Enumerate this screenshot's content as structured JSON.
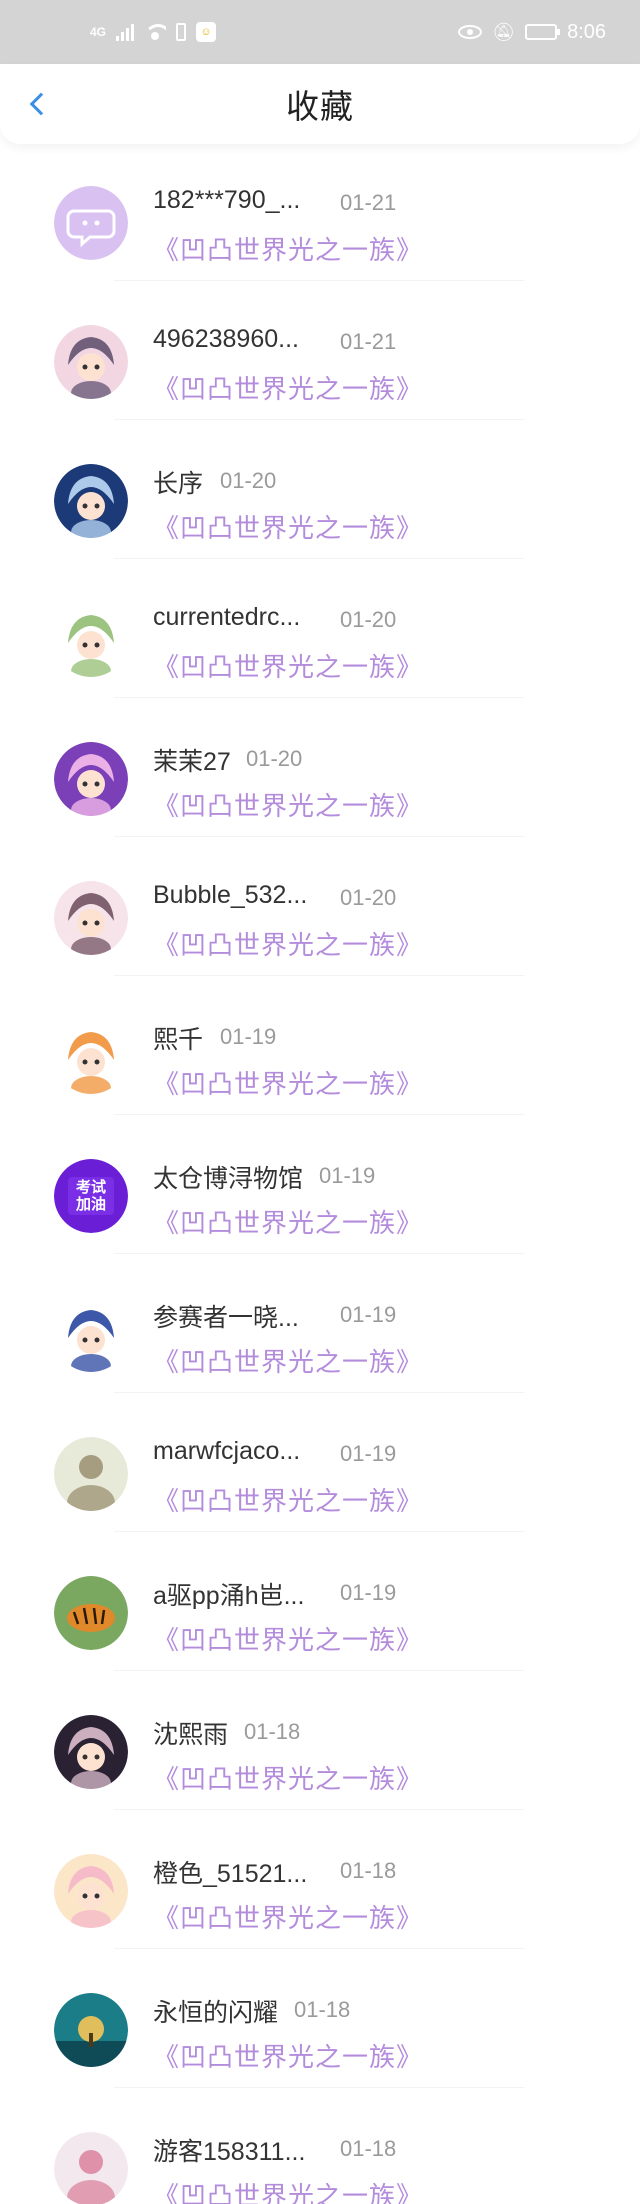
{
  "status_bar": {
    "carrier_badge": "4G",
    "time": "8:06",
    "icons": [
      "signal-icon",
      "wifi-icon",
      "battery-mini-icon",
      "notification-app-icon",
      "eye-icon",
      "bell-muted-icon",
      "battery-icon"
    ]
  },
  "header": {
    "title": "收藏",
    "back_icon": "chevron-left-icon",
    "accent": "#3a8ee6"
  },
  "work_title_color": "#b48cdc",
  "items": [
    {
      "user": "182***790_...",
      "date": "01-21",
      "work": "《凹凸世界光之一族》",
      "avatar": "chat-bubble-avatar"
    },
    {
      "user": "496238960...",
      "date": "01-21",
      "work": "《凹凸世界光之一族》",
      "avatar": "anime-avatar"
    },
    {
      "user": "长序",
      "date": "01-20",
      "work": "《凹凸世界光之一族》",
      "avatar": "anime-avatar"
    },
    {
      "user": "currentedrc...",
      "date": "01-20",
      "work": "《凹凸世界光之一族》",
      "avatar": "anime-avatar"
    },
    {
      "user": "茉茉27",
      "date": "01-20",
      "work": "《凹凸世界光之一族》",
      "avatar": "anime-avatar"
    },
    {
      "user": "Bubble_532...",
      "date": "01-20",
      "work": "《凹凸世界光之一族》",
      "avatar": "anime-avatar"
    },
    {
      "user": "熙千",
      "date": "01-19",
      "work": "《凹凸世界光之一族》",
      "avatar": "anime-avatar"
    },
    {
      "user": "太仓博浔物馆",
      "date": "01-19",
      "work": "《凹凸世界光之一族》",
      "avatar": "text-badge-avatar",
      "avatar_text": "考试加油"
    },
    {
      "user": "参赛者一晓...",
      "date": "01-19",
      "work": "《凹凸世界光之一族》",
      "avatar": "anime-avatar"
    },
    {
      "user": "marwfcjaco...",
      "date": "01-19",
      "work": "《凹凸世界光之一族》",
      "avatar": "photo-avatar"
    },
    {
      "user": "a驱pp涌h岜...",
      "date": "01-19",
      "work": "《凹凸世界光之一族》",
      "avatar": "tiger-avatar"
    },
    {
      "user": "沈熙雨",
      "date": "01-18",
      "work": "《凹凸世界光之一族》",
      "avatar": "anime-avatar"
    },
    {
      "user": "橙色_51521...",
      "date": "01-18",
      "work": "《凹凸世界光之一族》",
      "avatar": "anime-avatar"
    },
    {
      "user": "永恒的闪耀",
      "date": "01-18",
      "work": "《凹凸世界光之一族》",
      "avatar": "tree-avatar"
    },
    {
      "user": "游客158311...",
      "date": "01-18",
      "work": "《凹凸世界光之一族》",
      "avatar": "photo-avatar"
    }
  ]
}
